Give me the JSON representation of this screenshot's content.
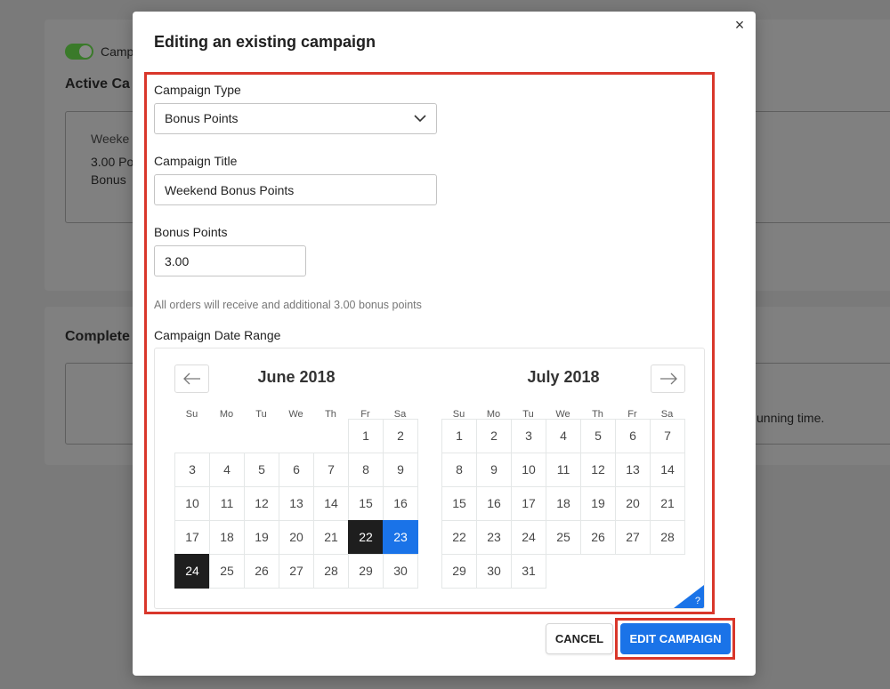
{
  "background": {
    "toggle_label": "Camp",
    "active_heading": "Active Ca",
    "card_title": "Weeke",
    "card_line1": "3.00 Po",
    "card_line2": "Bonus",
    "completed_heading": "Complete",
    "running_text": "unning time."
  },
  "modal": {
    "title": "Editing an existing campaign",
    "close_label": "×",
    "campaign_type": {
      "label": "Campaign Type",
      "value": "Bonus Points"
    },
    "campaign_title": {
      "label": "Campaign Title",
      "value": "Weekend Bonus Points"
    },
    "bonus_points": {
      "label": "Bonus Points",
      "value": "3.00"
    },
    "help_text": "All orders will receive and additional 3.00 bonus points",
    "date_range_label": "Campaign Date Range",
    "calendar": {
      "weekdays": [
        "Su",
        "Mo",
        "Tu",
        "We",
        "Th",
        "Fr",
        "Sa"
      ],
      "months": [
        {
          "title": "June 2018",
          "first_weekday": 5,
          "days": 30,
          "selected_dark": [
            22,
            24
          ],
          "selected_blue": [
            23
          ]
        },
        {
          "title": "July 2018",
          "first_weekday": 0,
          "days": 31,
          "selected_dark": [],
          "selected_blue": []
        }
      ],
      "help_glyph": "?"
    },
    "buttons": {
      "cancel": "CANCEL",
      "edit": "EDIT CAMPAIGN"
    }
  },
  "colors": {
    "accent": "#1a73e8",
    "highlight": "#d9372b",
    "selected_dark": "#1e1e1e"
  }
}
